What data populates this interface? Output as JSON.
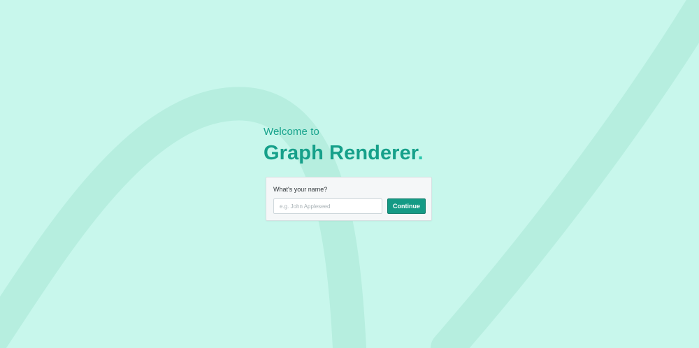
{
  "hero": {
    "welcome": "Welcome to",
    "title_part_1": "Graph Renderer",
    "title_part_2": "."
  },
  "form": {
    "label": "What's your name?",
    "name_placeholder": "e.g. John Appleseed",
    "name_value": "",
    "continue_label": "Continue"
  },
  "colors": {
    "background": "#c8f7ec",
    "swoosh": "#b6eedf",
    "accent_dark": "#16a08a",
    "accent_light": "#2bc7ad",
    "button": "#149a85"
  }
}
